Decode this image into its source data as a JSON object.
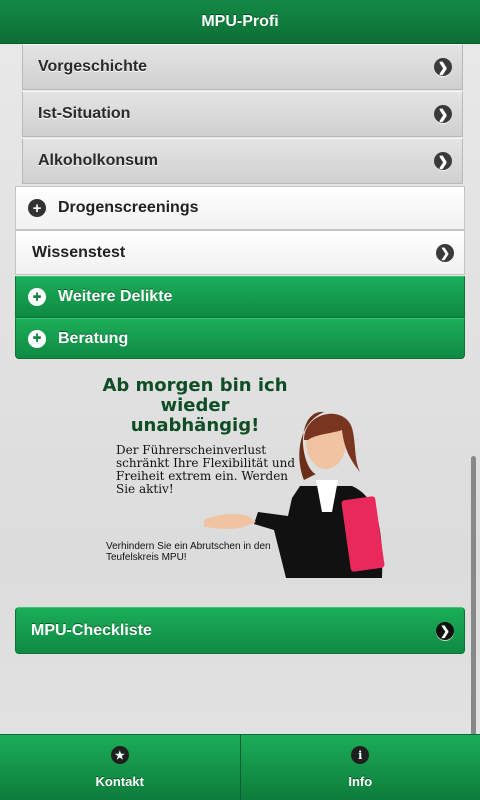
{
  "header": {
    "title": "MPU-Profi"
  },
  "menu": {
    "subitems": [
      {
        "label": "Vorgeschichte"
      },
      {
        "label": "Ist-Situation"
      },
      {
        "label": "Alkoholkonsum"
      }
    ],
    "drogenscreenings": {
      "label": "Drogenscreenings"
    },
    "wissenstest": {
      "label": "Wissenstest"
    },
    "weitere_delikte": {
      "label": "Weitere Delikte"
    },
    "beratung": {
      "label": "Beratung"
    }
  },
  "ad": {
    "headline": "Ab morgen bin ich wieder unabhängig!",
    "body": "Der Führerscheinverlust schränkt Ihre Flexibilität und Freiheit extrem ein. Werden Sie aktiv!",
    "footer": "Verhindern Sie ein Abrutschen in den Teufelskreis MPU!"
  },
  "checklist": {
    "label": "MPU-Checkliste"
  },
  "footer": {
    "tabs": [
      {
        "label": "Kontakt",
        "icon": "star-icon"
      },
      {
        "label": "Info",
        "icon": "info-icon"
      }
    ]
  },
  "colors": {
    "accent": "#138a45",
    "dark_icon": "#333333"
  }
}
